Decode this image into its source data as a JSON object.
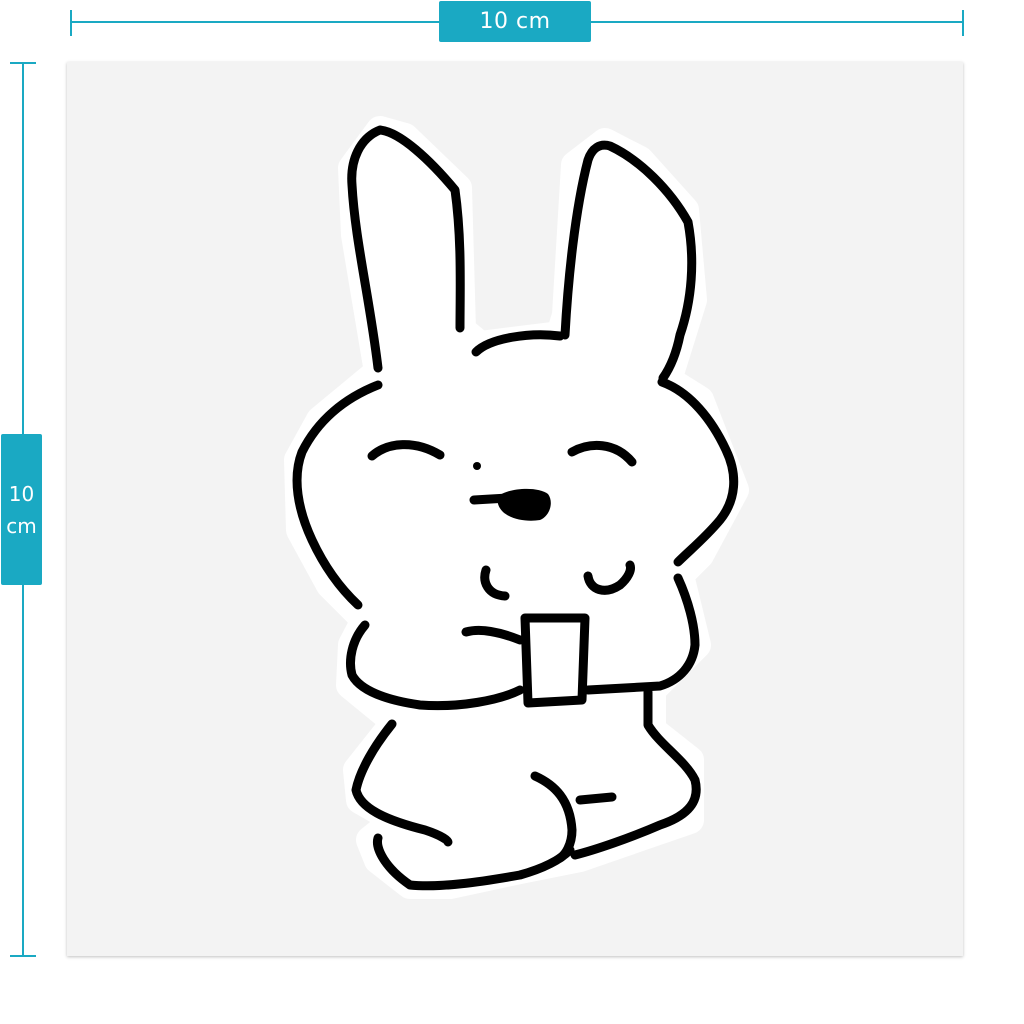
{
  "dimensions": {
    "width_label": "10 cm",
    "height_value": "10",
    "height_unit": "cm"
  },
  "icons": {
    "sticker": "bunny-sticker-icon"
  },
  "colors": {
    "accent": "#1aa9c3",
    "sheet": "#f3f3f3",
    "outline": "#000000"
  }
}
